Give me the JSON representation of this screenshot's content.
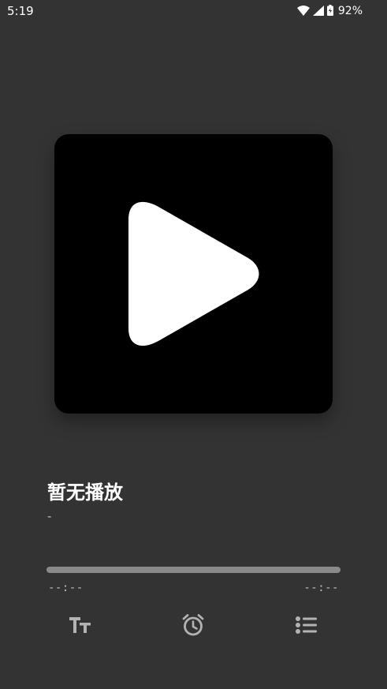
{
  "status_bar": {
    "time": "5:19",
    "battery_percent": "92%",
    "icons": [
      "wifi-icon",
      "signal-icon",
      "battery-icon"
    ]
  },
  "player": {
    "artwork_icon": "play-icon",
    "title": "暂无播放",
    "artist": "-",
    "progress": 0,
    "current_time": "--:--",
    "total_time": "--:--"
  },
  "controls": [
    "font-size-icon",
    "alarm-timer-icon",
    "playlist-icon"
  ],
  "colors": {
    "background": "#333333",
    "artwork_bg": "#000000",
    "progress_track": "#8a8a8a",
    "icon": "#b3b3b3"
  }
}
